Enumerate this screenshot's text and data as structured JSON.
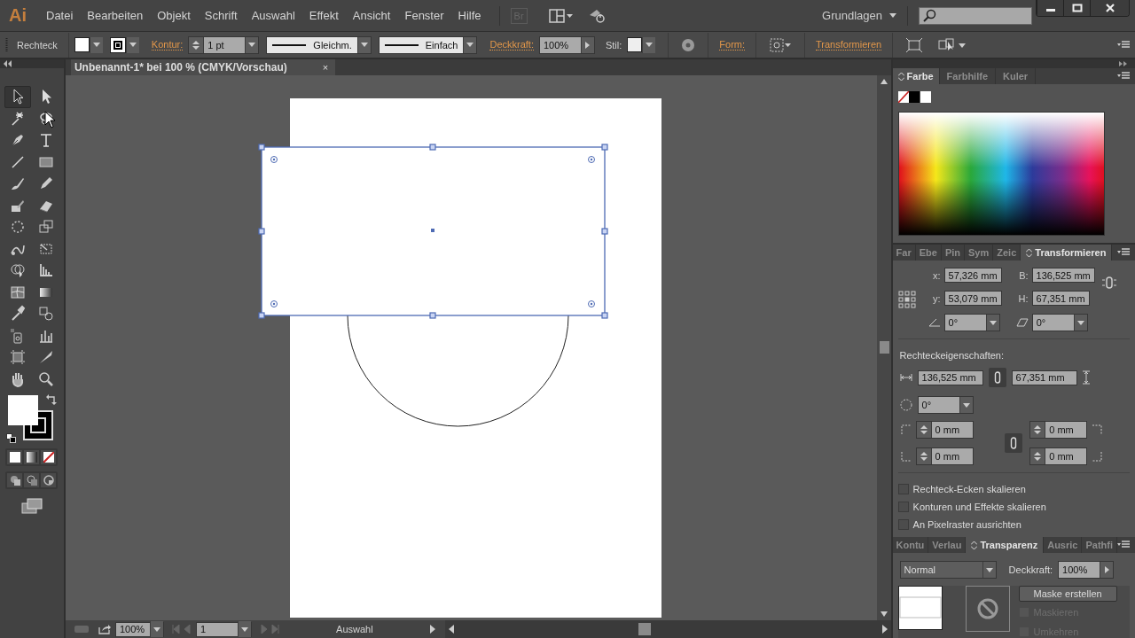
{
  "menu_bar": {
    "logo": "Ai",
    "items": [
      "Datei",
      "Bearbeiten",
      "Objekt",
      "Schrift",
      "Auswahl",
      "Effekt",
      "Ansicht",
      "Fenster",
      "Hilfe"
    ],
    "bridge": "Br",
    "workspace": "Grundlagen"
  },
  "control_bar": {
    "tool": "Rechteck",
    "stroke_label": "Kontur:",
    "stroke_weight": "1 pt",
    "profile": "Gleichm.",
    "brush": "Einfach",
    "opacity_label": "Deckkraft:",
    "opacity": "100%",
    "style_label": "Stil:",
    "shape_label": "Form:",
    "transform_label": "Transformieren"
  },
  "toolbox": {
    "tools": [
      {
        "selected": true
      },
      {
        "selected": false
      },
      {
        "selected": false
      },
      {
        "selected": false
      },
      {
        "selected": false
      },
      {
        "selected": false
      },
      {
        "selected": false
      },
      {
        "selected": false
      },
      {
        "selected": false
      },
      {
        "selected": false
      },
      {
        "selected": false
      },
      {
        "selected": false
      },
      {
        "selected": false
      },
      {
        "selected": false
      },
      {
        "selected": false
      },
      {
        "selected": false
      },
      {
        "selected": false
      },
      {
        "selected": false
      },
      {
        "selected": false
      },
      {
        "selected": false
      },
      {
        "selected": false
      },
      {
        "selected": false
      },
      {
        "selected": false
      },
      {
        "selected": false
      },
      {
        "selected": false
      },
      {
        "selected": false
      },
      {
        "selected": false
      },
      {
        "selected": false
      }
    ]
  },
  "document": {
    "tab_title": "Unbenannt-1* bei 100 % (CMYK/Vorschau)",
    "close": "×"
  },
  "status_bar": {
    "zoom": "100%",
    "artboard": "1",
    "tool": "Auswahl"
  },
  "color_panel": {
    "tabs": [
      {
        "label": "Farbe",
        "selected": true
      },
      {
        "label": "Farbhilfe",
        "selected": false
      },
      {
        "label": "Kuler",
        "selected": false
      }
    ]
  },
  "transform_panel": {
    "tabs": [
      {
        "label": "Far",
        "selected": false
      },
      {
        "label": "Ebe",
        "selected": false
      },
      {
        "label": "Pin",
        "selected": false
      },
      {
        "label": "Sym",
        "selected": false
      },
      {
        "label": "Zeic",
        "selected": false
      },
      {
        "label": "Transformieren",
        "selected": true
      }
    ],
    "fields": [
      {
        "label": "x:",
        "value": "57,326 mm"
      },
      {
        "label": "B:",
        "value": "136,525 mm"
      },
      {
        "label": "y:",
        "value": "53,079 mm"
      },
      {
        "label": "H:",
        "value": "67,351 mm"
      }
    ],
    "angle": "0°",
    "shear": "0°",
    "rect_title": "Rechteckeigenschaften:",
    "rect_width": "136,525 mm",
    "rect_height": "67,351 mm",
    "rect_rotation": "0°",
    "corners": [
      "0 mm",
      "0 mm",
      "0 mm",
      "0 mm"
    ],
    "options": [
      {
        "label": "Rechteck-Ecken skalieren",
        "checked": false
      },
      {
        "label": "Konturen und Effekte skalieren",
        "checked": false
      },
      {
        "label": "An Pixelraster ausrichten",
        "checked": false
      }
    ]
  },
  "transparency_panel": {
    "tabs": [
      {
        "label": "Kontu",
        "selected": false
      },
      {
        "label": "Verlau",
        "selected": false
      },
      {
        "label": "Transparenz",
        "selected": true
      },
      {
        "label": "Ausric",
        "selected": false
      },
      {
        "label": "Pathfi",
        "selected": false
      }
    ],
    "blend_mode": "Normal",
    "opacity_label": "Deckkraft:",
    "opacity": "100%",
    "mask_button": "Maske erstellen",
    "options": [
      {
        "label": "Maskieren",
        "checked": false,
        "disabled": true
      },
      {
        "label": "Umkehren",
        "checked": false,
        "disabled": true
      }
    ]
  }
}
